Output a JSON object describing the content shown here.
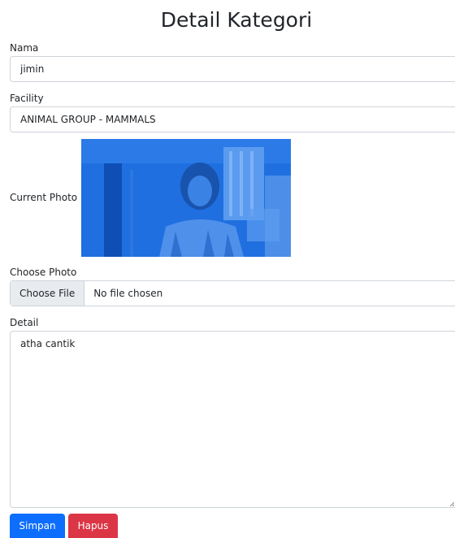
{
  "page": {
    "title": "Detail Kategori"
  },
  "form": {
    "nama": {
      "label": "Nama",
      "value": "jimin"
    },
    "facility": {
      "label": "Facility",
      "value": "ANIMAL GROUP - MAMMALS"
    },
    "current_photo": {
      "label": "Current Photo"
    },
    "choose_photo": {
      "label": "Choose Photo",
      "button_label": "Choose File",
      "status": "No file chosen"
    },
    "detail": {
      "label": "Detail",
      "value": "atha cantik"
    }
  },
  "actions": {
    "save_label": "Simpan",
    "delete_label": "Hapus"
  },
  "colors": {
    "primary": "#0d6efd",
    "danger": "#dc3545",
    "photo_tint": "#1f6fe0"
  }
}
